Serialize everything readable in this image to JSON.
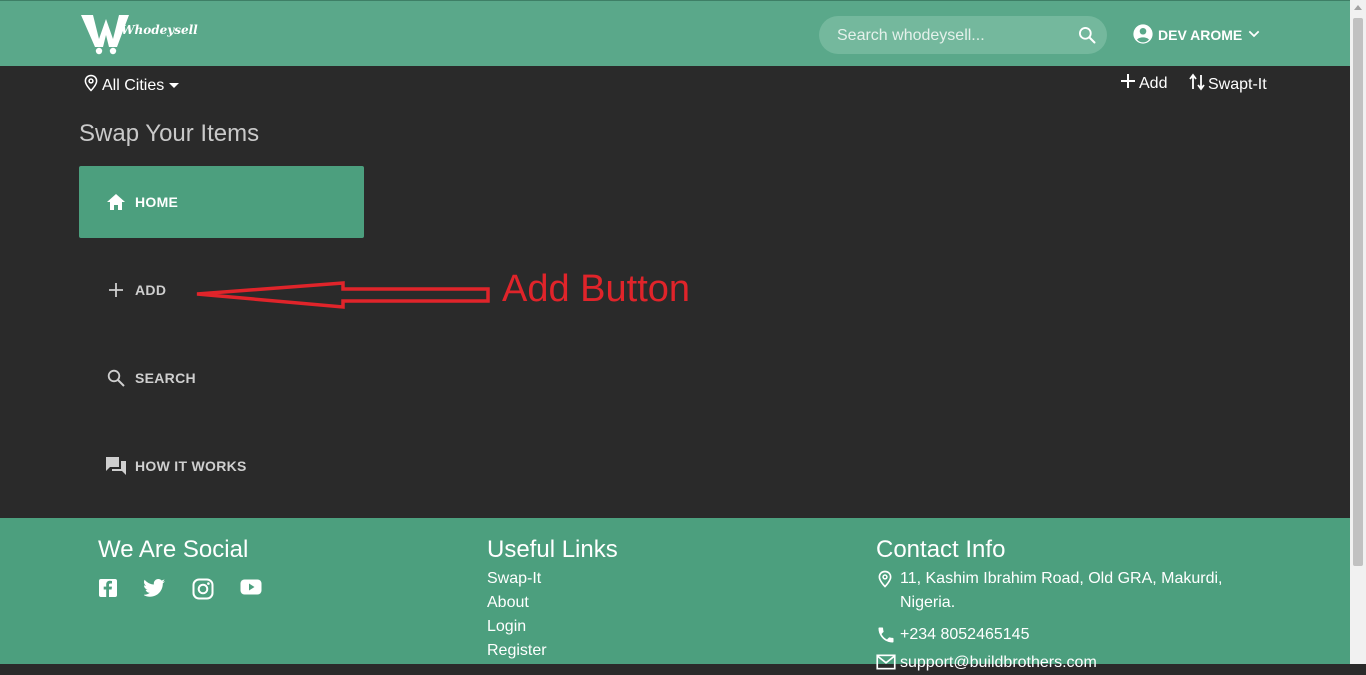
{
  "header": {
    "logo_text": "Whodeysell",
    "search_placeholder": "Search whodeysell...",
    "user_name": "DEV AROME"
  },
  "subbar": {
    "cities_label": "All Cities",
    "add_label": "Add",
    "swap_label": "Swapt-It"
  },
  "main": {
    "title": "Swap Your Items",
    "nav": [
      {
        "label": "HOME",
        "icon": "home-icon"
      },
      {
        "label": "ADD",
        "icon": "plus-icon"
      },
      {
        "label": "SEARCH",
        "icon": "search-icon"
      },
      {
        "label": "HOW IT WORKS",
        "icon": "chat-icon"
      }
    ]
  },
  "annotation": {
    "text": "Add Button",
    "color": "#e0242a"
  },
  "footer": {
    "social_title": "We Are Social",
    "social_icons": [
      "facebook-icon",
      "twitter-icon",
      "instagram-icon",
      "youtube-icon"
    ],
    "links_title": "Useful Links",
    "links": [
      "Swap-It",
      "About",
      "Login",
      "Register"
    ],
    "contact_title": "Contact Info",
    "address_line1": "11, Kashim Ibrahim Road, Old GRA, Makurdi,",
    "address_line2": "Nigeria.",
    "phone": "+234 8052465145",
    "email": "support@buildbrothers.com"
  },
  "colors": {
    "header": "#5aa88a",
    "footer": "#4c9f7e",
    "background": "#2a2a2a",
    "active_nav": "#4c9f7e"
  }
}
